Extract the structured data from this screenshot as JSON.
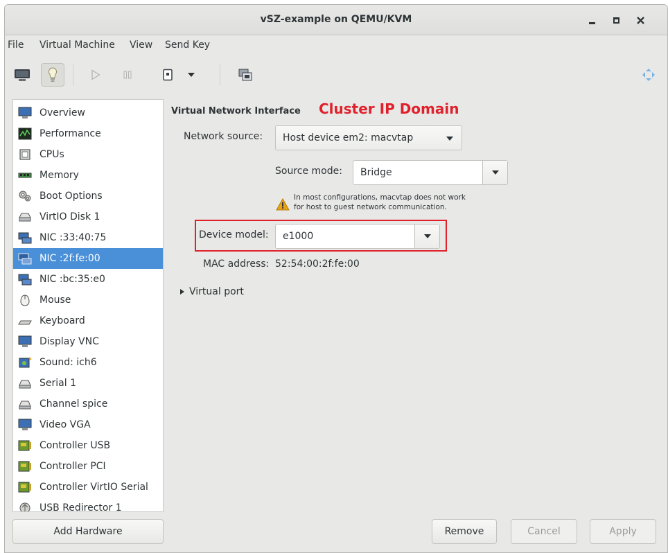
{
  "window": {
    "title": "vSZ-example on QEMU/KVM"
  },
  "menu": [
    "File",
    "Virtual Machine",
    "View",
    "Send Key"
  ],
  "toolbar": {
    "icons": [
      "console-icon",
      "details-icon",
      "run-icon",
      "pause-icon",
      "shutdown-icon",
      "shutdown-menu-icon",
      "snapshots-icon",
      "fullscreen-icon"
    ]
  },
  "sidebar": {
    "items": [
      {
        "label": "Overview",
        "icon": "overview-icon"
      },
      {
        "label": "Performance",
        "icon": "performance-icon"
      },
      {
        "label": "CPUs",
        "icon": "cpu-icon"
      },
      {
        "label": "Memory",
        "icon": "memory-icon"
      },
      {
        "label": "Boot Options",
        "icon": "boot-options-icon"
      },
      {
        "label": "VirtIO Disk 1",
        "icon": "disk-icon"
      },
      {
        "label": "NIC :33:40:75",
        "icon": "nic-icon"
      },
      {
        "label": "NIC :2f:fe:00",
        "icon": "nic-icon",
        "selected": true
      },
      {
        "label": "NIC :bc:35:e0",
        "icon": "nic-icon"
      },
      {
        "label": "Mouse",
        "icon": "mouse-icon"
      },
      {
        "label": "Keyboard",
        "icon": "keyboard-icon"
      },
      {
        "label": "Display VNC",
        "icon": "display-icon"
      },
      {
        "label": "Sound: ich6",
        "icon": "sound-icon"
      },
      {
        "label": "Serial 1",
        "icon": "serial-icon"
      },
      {
        "label": "Channel spice",
        "icon": "channel-icon"
      },
      {
        "label": "Video VGA",
        "icon": "video-icon"
      },
      {
        "label": "Controller USB",
        "icon": "controller-icon"
      },
      {
        "label": "Controller PCI",
        "icon": "controller-icon"
      },
      {
        "label": "Controller VirtIO Serial",
        "icon": "controller-icon"
      },
      {
        "label": "USB Redirector 1",
        "icon": "usb-redirector-icon"
      }
    ],
    "add_hardware": "Add Hardware"
  },
  "main": {
    "section_title": "Virtual Network Interface",
    "annotation": "Cluster IP Domain",
    "network_source": {
      "label": "Network source:",
      "value": "Host device em2: macvtap"
    },
    "source_mode": {
      "label": "Source mode:",
      "value": "Bridge"
    },
    "warning": {
      "line1": "In most configurations, macvtap does not work",
      "line2": "for host to guest network communication."
    },
    "device_model": {
      "label": "Device model:",
      "value": "e1000"
    },
    "mac_address": {
      "label": "MAC address:",
      "value": "52:54:00:2f:fe:00"
    },
    "virtual_port": "Virtual port"
  },
  "buttons": {
    "remove": "Remove",
    "cancel": "Cancel",
    "apply": "Apply"
  },
  "colors": {
    "selection": "#4a90d9",
    "annotation": "#e0212b",
    "warning": "#e8a317"
  }
}
